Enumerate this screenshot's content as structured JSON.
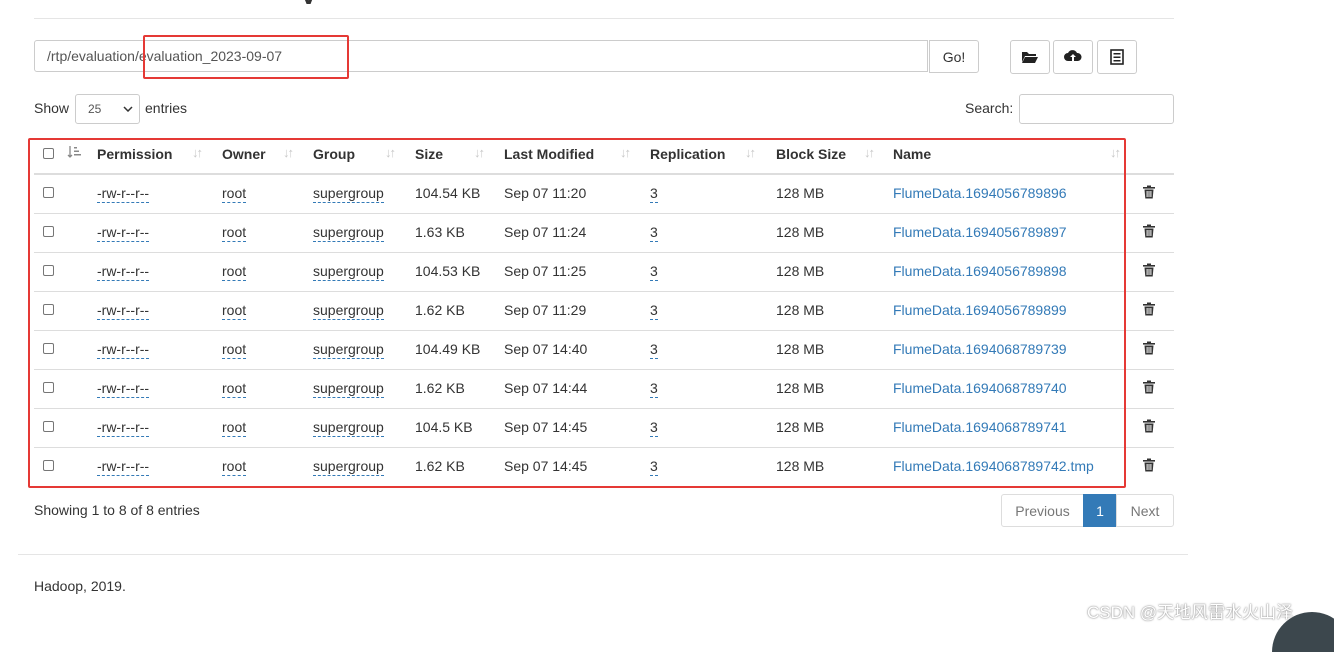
{
  "header": {
    "title_tail": "y"
  },
  "path_bar": {
    "value": "/rtp/evaluation/evaluation_2023-09-07",
    "go_label": "Go!"
  },
  "toolbar": {
    "icons": [
      "folder-open-icon",
      "cloud-upload-icon",
      "list-icon"
    ]
  },
  "length_control": {
    "show_label": "Show",
    "selected": "25",
    "entries_label": "entries"
  },
  "search": {
    "label": "Search:",
    "value": ""
  },
  "table": {
    "columns": [
      "Permission",
      "Owner",
      "Group",
      "Size",
      "Last Modified",
      "Replication",
      "Block Size",
      "Name"
    ],
    "rows": [
      {
        "permission": "-rw-r--r--",
        "owner": "root",
        "group": "supergroup",
        "size": "104.54 KB",
        "modified": "Sep 07 11:20",
        "replication": "3",
        "block": "128 MB",
        "name": "FlumeData.1694056789896"
      },
      {
        "permission": "-rw-r--r--",
        "owner": "root",
        "group": "supergroup",
        "size": "1.63 KB",
        "modified": "Sep 07 11:24",
        "replication": "3",
        "block": "128 MB",
        "name": "FlumeData.1694056789897"
      },
      {
        "permission": "-rw-r--r--",
        "owner": "root",
        "group": "supergroup",
        "size": "104.53 KB",
        "modified": "Sep 07 11:25",
        "replication": "3",
        "block": "128 MB",
        "name": "FlumeData.1694056789898"
      },
      {
        "permission": "-rw-r--r--",
        "owner": "root",
        "group": "supergroup",
        "size": "1.62 KB",
        "modified": "Sep 07 11:29",
        "replication": "3",
        "block": "128 MB",
        "name": "FlumeData.1694056789899"
      },
      {
        "permission": "-rw-r--r--",
        "owner": "root",
        "group": "supergroup",
        "size": "104.49 KB",
        "modified": "Sep 07 14:40",
        "replication": "3",
        "block": "128 MB",
        "name": "FlumeData.1694068789739"
      },
      {
        "permission": "-rw-r--r--",
        "owner": "root",
        "group": "supergroup",
        "size": "1.62 KB",
        "modified": "Sep 07 14:44",
        "replication": "3",
        "block": "128 MB",
        "name": "FlumeData.1694068789740"
      },
      {
        "permission": "-rw-r--r--",
        "owner": "root",
        "group": "supergroup",
        "size": "104.5 KB",
        "modified": "Sep 07 14:45",
        "replication": "3",
        "block": "128 MB",
        "name": "FlumeData.1694068789741"
      },
      {
        "permission": "-rw-r--r--",
        "owner": "root",
        "group": "supergroup",
        "size": "1.62 KB",
        "modified": "Sep 07 14:45",
        "replication": "3",
        "block": "128 MB",
        "name": "FlumeData.1694068789742.tmp"
      }
    ],
    "row_icon": "trash-icon"
  },
  "info": "Showing 1 to 8 of 8 entries",
  "pagination": {
    "previous": "Previous",
    "current": "1",
    "next": "Next"
  },
  "footer": "Hadoop, 2019.",
  "watermark": "CSDN @天地风雷水火山泽",
  "colors": {
    "link": "#337ab7",
    "highlight": "#e53935",
    "active_page": "#337ab7"
  }
}
